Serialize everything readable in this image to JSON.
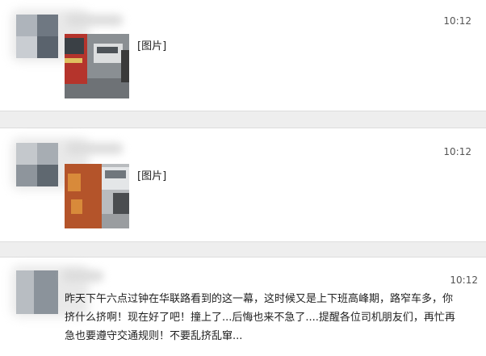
{
  "messages": [
    {
      "time": "10:12",
      "content": "[图片]"
    },
    {
      "time": "10:12",
      "content": "[图片]"
    },
    {
      "time": "10:12",
      "content": "昨天下午六点过钟在华联路看到的这一幕，这时候又是上下班高峰期，路窄车多，你挤什么挤啊！现在好了吧！撞上了...后悔也来不急了....提醒各位司机朋友们，再忙再急也要遵守交通规则！不要乱挤乱窜..."
    }
  ],
  "colors": {
    "background": "#eeeeee",
    "card": "#ffffff",
    "text": "#222222",
    "time": "#555555"
  }
}
